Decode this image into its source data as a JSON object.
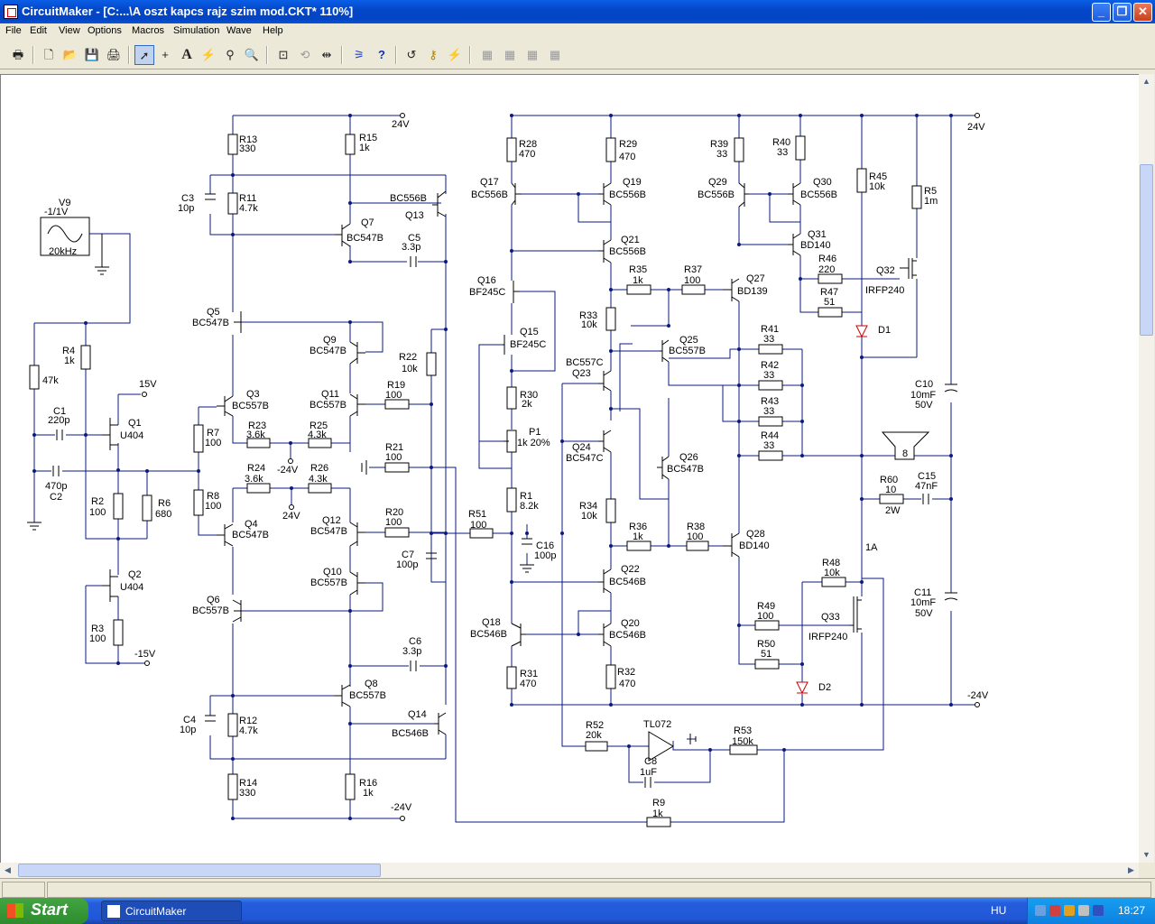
{
  "window": {
    "title": "CircuitMaker - [C:...\\A oszt kapcs rajz szim mod.CKT* 110%]"
  },
  "menu": [
    "File",
    "Edit",
    "View",
    "Options",
    "Macros",
    "Simulation",
    "Wave",
    "Help"
  ],
  "toolbar": {
    "icons": [
      "print-setup-icon",
      "new-icon",
      "open-icon",
      "save-icon",
      "print-icon",
      "arrow-tool-icon",
      "wire-tool-icon",
      "text-tool-icon",
      "probe-tool-icon",
      "wand-icon",
      "zoom-icon",
      "zoom-fit-icon",
      "rotate-icon",
      "mirror-icon",
      "netlist-icon",
      "help-icon",
      "undo-icon",
      "key-icon",
      "wave-icon",
      "macro-icon-1",
      "macro-icon-2",
      "macro-icon-3",
      "macro-icon-4"
    ]
  },
  "schematic": {
    "rails": {
      "pos_a": "24V",
      "neg_a": "-24V",
      "pos_b": "24V",
      "neg_b": "-24V",
      "p15": "15V",
      "n15": "-15V",
      "m24": "-24V",
      "p24": "24V"
    },
    "source": {
      "name": "V9",
      "value": "-1/1V",
      "freq": "20kHz"
    },
    "resistors": [
      {
        "n": "R13",
        "v": "330"
      },
      {
        "n": "R15",
        "v": "1k"
      },
      {
        "n": "R11",
        "v": "4.7k"
      },
      {
        "n": "R4",
        "v": "1k"
      },
      {
        "n": "R47k",
        "v": "47k"
      },
      {
        "n": "R7",
        "v": "100"
      },
      {
        "n": "R8",
        "v": "100"
      },
      {
        "n": "R23",
        "v": "3.6k"
      },
      {
        "n": "R25",
        "v": "4.3k"
      },
      {
        "n": "R24",
        "v": "3.6k"
      },
      {
        "n": "R26",
        "v": "4.3k"
      },
      {
        "n": "R2",
        "v": "100"
      },
      {
        "n": "R6",
        "v": "680"
      },
      {
        "n": "R3",
        "v": "100"
      },
      {
        "n": "R22",
        "v": "10k"
      },
      {
        "n": "R19",
        "v": "100"
      },
      {
        "n": "R21",
        "v": "100"
      },
      {
        "n": "R20",
        "v": "100"
      },
      {
        "n": "R12",
        "v": "4.7k"
      },
      {
        "n": "R14",
        "v": "330"
      },
      {
        "n": "R16",
        "v": "1k"
      },
      {
        "n": "R51",
        "v": "100"
      },
      {
        "n": "R28",
        "v": "470"
      },
      {
        "n": "R29",
        "v": "470"
      },
      {
        "n": "R39",
        "v": "33"
      },
      {
        "n": "R40",
        "v": "33"
      },
      {
        "n": "R45",
        "v": "10k"
      },
      {
        "n": "R5",
        "v": "1m"
      },
      {
        "n": "R35",
        "v": "1k"
      },
      {
        "n": "R37",
        "v": "100"
      },
      {
        "n": "R46",
        "v": "220"
      },
      {
        "n": "R47",
        "v": "51"
      },
      {
        "n": "R33",
        "v": "10k"
      },
      {
        "n": "R41",
        "v": "33"
      },
      {
        "n": "R42",
        "v": "33"
      },
      {
        "n": "R43",
        "v": "33"
      },
      {
        "n": "R44",
        "v": "33"
      },
      {
        "n": "R30",
        "v": "2k"
      },
      {
        "n": "R1",
        "v": "8.2k"
      },
      {
        "n": "R34",
        "v": "10k"
      },
      {
        "n": "R36",
        "v": "1k"
      },
      {
        "n": "R38",
        "v": "100"
      },
      {
        "n": "R60",
        "v": "10"
      },
      {
        "n": "R48",
        "v": "10k"
      },
      {
        "n": "R49",
        "v": "100"
      },
      {
        "n": "R50",
        "v": "51"
      },
      {
        "n": "R31",
        "v": "470"
      },
      {
        "n": "R32",
        "v": "470"
      },
      {
        "n": "R52",
        "v": "20k"
      },
      {
        "n": "R53",
        "v": "150k"
      },
      {
        "n": "R9",
        "v": "1k"
      }
    ],
    "capacitors": [
      {
        "n": "C3",
        "v": "10p"
      },
      {
        "n": "C5",
        "v": "3.3p"
      },
      {
        "n": "C1",
        "v": "220p"
      },
      {
        "n": "C2",
        "v": "470p"
      },
      {
        "n": "C7",
        "v": "100p"
      },
      {
        "n": "C6",
        "v": "3.3p"
      },
      {
        "n": "C4",
        "v": "10p"
      },
      {
        "n": "C16",
        "v": "100p"
      },
      {
        "n": "C10",
        "v": "10mF",
        "v2": "50V"
      },
      {
        "n": "C11",
        "v": "10mF",
        "v2": "50V"
      },
      {
        "n": "C15",
        "v": "47nF"
      },
      {
        "n": "C8",
        "v": "1uF"
      }
    ],
    "transistors": [
      {
        "n": "Q13",
        "t": "BC556B"
      },
      {
        "n": "Q7",
        "t": "BC547B"
      },
      {
        "n": "Q5",
        "t": "BC547B"
      },
      {
        "n": "Q9",
        "t": "BC547B"
      },
      {
        "n": "Q3",
        "t": "BC557B"
      },
      {
        "n": "Q11",
        "t": "BC557B"
      },
      {
        "n": "Q1",
        "t": "U404"
      },
      {
        "n": "Q4",
        "t": "BC547B"
      },
      {
        "n": "Q12",
        "t": "BC547B"
      },
      {
        "n": "Q2",
        "t": "U404"
      },
      {
        "n": "Q10",
        "t": "BC557B"
      },
      {
        "n": "Q6",
        "t": "BC557B"
      },
      {
        "n": "Q8",
        "t": "BC557B"
      },
      {
        "n": "Q14",
        "t": "BC546B"
      },
      {
        "n": "Q17",
        "t": "BC556B"
      },
      {
        "n": "Q19",
        "t": "BC556B"
      },
      {
        "n": "Q21",
        "t": "BC556B"
      },
      {
        "n": "Q29",
        "t": "BC556B"
      },
      {
        "n": "Q30",
        "t": "BC556B"
      },
      {
        "n": "Q31",
        "t": "BD140"
      },
      {
        "n": "Q16",
        "t": "BF245C"
      },
      {
        "n": "Q15",
        "t": "BF245C"
      },
      {
        "n": "Q27",
        "t": "BD139"
      },
      {
        "n": "Q32",
        "t": "IRFP240"
      },
      {
        "n": "Q25",
        "t": "BC557B"
      },
      {
        "n": "Q23",
        "t": "BC557C"
      },
      {
        "n": "Q24",
        "t": "BC547C"
      },
      {
        "n": "Q26",
        "t": "BC547B"
      },
      {
        "n": "Q28",
        "t": "BD140"
      },
      {
        "n": "Q22",
        "t": "BC546B"
      },
      {
        "n": "Q20",
        "t": "BC546B"
      },
      {
        "n": "Q18",
        "t": "BC546B"
      },
      {
        "n": "Q33",
        "t": "IRFP240"
      }
    ],
    "misc": {
      "p1": "P1",
      "p1v": "1k 20%",
      "d1": "D1",
      "d2": "D2",
      "fuse": "1A",
      "r60w": "2W",
      "speaker": "8",
      "opamp": "TL072"
    }
  },
  "statusbar": {
    "text": ""
  },
  "taskbar": {
    "start": "Start",
    "task": "CircuitMaker",
    "lang": "HU",
    "clock": "18:27"
  }
}
